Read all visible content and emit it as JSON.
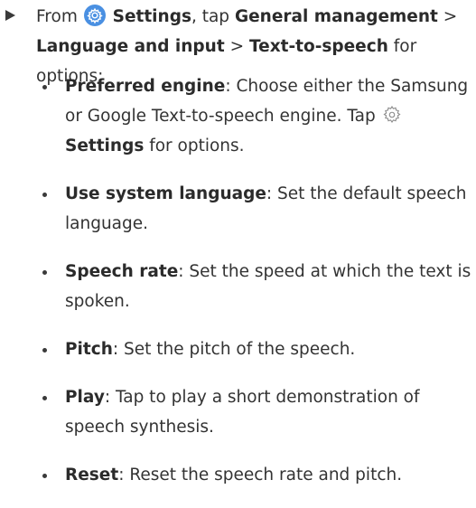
{
  "intro": {
    "from": "From",
    "settings": "Settings",
    "sep1": ", tap",
    "general": "General management",
    "chev1": ">",
    "language": "Language and input",
    "chev2": ">",
    "tts": "Text-to-speech",
    "tail": "for options:",
    "settings_icon": "settings-gear-icon"
  },
  "options": [
    {
      "term": "Preferred engine",
      "desc": ": Choose either the Samsung or Google Text-to-speech engine. Tap",
      "icon": "settings-outline-gear-icon",
      "settings": "Settings",
      "tail": "for options."
    },
    {
      "term": "Use system language",
      "desc": ": Set the default speech language."
    },
    {
      "term": "Speech rate",
      "desc": ": Set the speed at which the text is spoken."
    },
    {
      "term": "Pitch",
      "desc": ": Set the pitch of the speech."
    },
    {
      "term": "Play",
      "desc": ": Tap to play a short demonstration of speech synthesis."
    },
    {
      "term": "Reset",
      "desc": ": Reset the speech rate and pitch."
    }
  ],
  "colors": {
    "accent": "#4a90e2",
    "text": "#333333"
  }
}
